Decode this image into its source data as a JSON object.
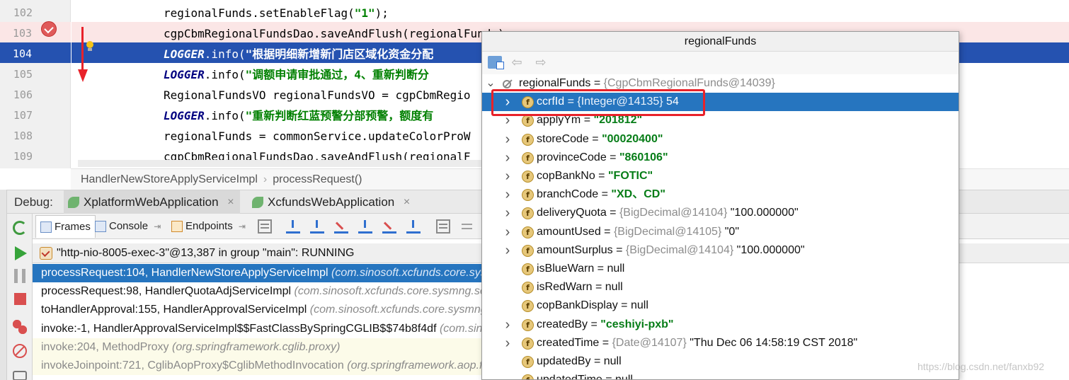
{
  "editor": {
    "lines": [
      {
        "num": "102",
        "parts": [
          {
            "t": "regionalFunds.setEnableFlag(",
            "c": ""
          },
          {
            "t": "\"1\"",
            "c": "str"
          },
          {
            "t": ");",
            "c": ""
          }
        ]
      },
      {
        "num": "103",
        "parts": [
          {
            "t": "cgpCbmRegionalFundsDao.saveAndFlush(regionalFunds);",
            "c": ""
          }
        ]
      },
      {
        "num": "104",
        "parts": [
          {
            "t": "LOGGER",
            "c": "kw"
          },
          {
            "t": ".info(",
            "c": ""
          },
          {
            "t": "\"根据明细新增新门店区域化资金分配",
            "c": "str"
          }
        ]
      },
      {
        "num": "105",
        "parts": [
          {
            "t": "LOGGER",
            "c": "kw"
          },
          {
            "t": ".info(",
            "c": ""
          },
          {
            "t": "\"调额申请审批通过，4、重新判断分",
            "c": "str"
          }
        ]
      },
      {
        "num": "106",
        "parts": [
          {
            "t": "RegionalFundsVO regionalFundsVO = cgpCbmRegio",
            "c": ""
          }
        ]
      },
      {
        "num": "107",
        "parts": [
          {
            "t": "LOGGER",
            "c": "kw"
          },
          {
            "t": ".info(",
            "c": ""
          },
          {
            "t": "\"重新判断红蓝预警分部预警，额度有",
            "c": "str"
          }
        ]
      },
      {
        "num": "108",
        "parts": [
          {
            "t": "regionalFunds = commonService.updateColorProW",
            "c": ""
          }
        ]
      },
      {
        "num": "109",
        "parts": [
          {
            "t": "cgpCbmRegionalFundsDao.saveAndFlush(regionalF",
            "c": ""
          }
        ]
      }
    ],
    "current_line": "104",
    "breakpoint_line": "103"
  },
  "breadcrumb": {
    "class_name": "HandlerNewStoreApplyServiceImpl",
    "separator": "›",
    "method_name": "processRequest()"
  },
  "debug": {
    "label": "Debug:",
    "sessions": [
      {
        "name": "XplatformWebApplication",
        "close": "×"
      },
      {
        "name": "XcfundsWebApplication",
        "close": "×"
      }
    ],
    "tabs": {
      "frames": "Frames",
      "console": "Console",
      "endpoints": "Endpoints",
      "pin": "⇥"
    },
    "thread": "\"http-nio-8005-exec-3\"@13,387 in group \"main\": RUNNING",
    "frames": [
      {
        "method": "processRequest:104, HandlerNewStoreApplyServiceImpl",
        "pkg": "(com.sinosoft.xcfunds.core.sysmng.service.impl)",
        "kind": "sel"
      },
      {
        "method": "processRequest:98, HandlerQuotaAdjServiceImpl",
        "pkg": "(com.sinosoft.xcfunds.core.sysmng.service.impl)",
        "kind": ""
      },
      {
        "method": "toHandlerApproval:155, HandlerApprovalServiceImpl",
        "pkg": "(com.sinosoft.xcfunds.core.sysmng.service.impl)",
        "kind": ""
      },
      {
        "method": "invoke:-1, HandlerApprovalServiceImpl$$FastClassBySpringCGLIB$$74b8f4df",
        "pkg": "(com.sinosoft.xcfunds.core)",
        "kind": ""
      },
      {
        "method": "invoke:204, MethodProxy",
        "pkg": "(org.springframework.cglib.proxy)",
        "kind": "lib"
      },
      {
        "method": "invokeJoinpoint:721, CglibAopProxy$CglibMethodInvocation",
        "pkg": "(org.springframework.aop.framework)",
        "kind": "lib"
      }
    ]
  },
  "popup": {
    "title": "regionalFunds",
    "back_arrow": "⇦",
    "forward_arrow": "⇨",
    "field_badge": "f",
    "rows": [
      {
        "name": "regionalFunds",
        "ref": "{CgpCbmRegionalFunds@14039}",
        "val": "",
        "plain": "",
        "expand": "open",
        "root": true
      },
      {
        "name": "ccrfId",
        "ref": "{Integer@14135}",
        "val": "",
        "plain": "54",
        "expand": "closed",
        "sel": true
      },
      {
        "name": "applyYm",
        "ref": "",
        "val": "\"201812\"",
        "plain": "",
        "expand": "closed"
      },
      {
        "name": "storeCode",
        "ref": "",
        "val": "\"00020400\"",
        "plain": "",
        "expand": "closed"
      },
      {
        "name": "provinceCode",
        "ref": "",
        "val": "\"860106\"",
        "plain": "",
        "expand": "closed"
      },
      {
        "name": "copBankNo",
        "ref": "",
        "val": "\"FOTIC\"",
        "plain": "",
        "expand": "closed"
      },
      {
        "name": "branchCode",
        "ref": "",
        "val": "\"XD、CD\"",
        "plain": "",
        "expand": "closed"
      },
      {
        "name": "deliveryQuota",
        "ref": "{BigDecimal@14104}",
        "val": "",
        "plain": "\"100.000000\"",
        "expand": "closed"
      },
      {
        "name": "amountUsed",
        "ref": "{BigDecimal@14105}",
        "val": "",
        "plain": "\"0\"",
        "expand": "closed"
      },
      {
        "name": "amountSurplus",
        "ref": "{BigDecimal@14104}",
        "val": "",
        "plain": "\"100.000000\"",
        "expand": "closed"
      },
      {
        "name": "isBlueWarn",
        "ref": "",
        "val": "",
        "plain": "null",
        "expand": "none"
      },
      {
        "name": "isRedWarn",
        "ref": "",
        "val": "",
        "plain": "null",
        "expand": "none"
      },
      {
        "name": "copBankDisplay",
        "ref": "",
        "val": "",
        "plain": "null",
        "expand": "none"
      },
      {
        "name": "createdBy",
        "ref": "",
        "val": "\"ceshiyi-pxb\"",
        "plain": "",
        "expand": "closed"
      },
      {
        "name": "createdTime",
        "ref": "{Date@14107}",
        "val": "",
        "plain": "\"Thu Dec 06 14:58:19 CST 2018\"",
        "expand": "closed"
      },
      {
        "name": "updatedBy",
        "ref": "",
        "val": "",
        "plain": "null",
        "expand": "none"
      },
      {
        "name": "updatedTime",
        "ref": "",
        "val": "",
        "plain": "null",
        "expand": "none"
      }
    ]
  },
  "watermark": "https://blog.csdn.net/fanxb92",
  "colors": {
    "selection": "#2675bf",
    "current_line": "#2552b0",
    "breakpoint_line": "#fbe6e6",
    "annotation_red": "#e8222a",
    "string_green": "#067d17"
  }
}
